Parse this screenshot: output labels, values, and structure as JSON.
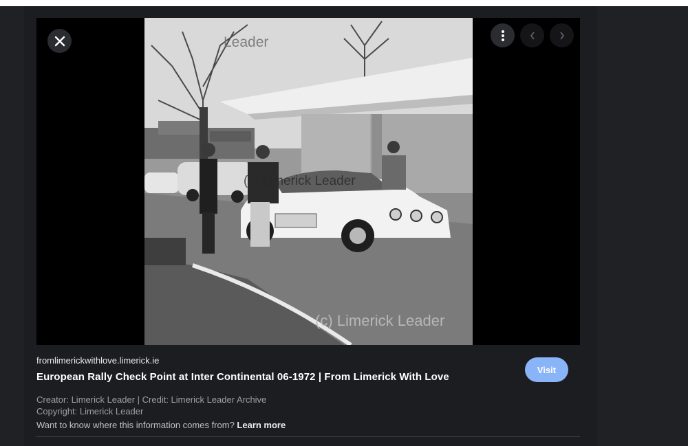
{
  "image": {
    "watermark": "(c) Limerick Leader",
    "watermark_top": "Leader"
  },
  "controls": {
    "close_icon": "close-icon",
    "more_icon": "more-vert-icon",
    "prev_icon": "chevron-left-icon",
    "next_icon": "chevron-right-icon"
  },
  "result": {
    "source": "fromlimerickwithlove.limerick.ie",
    "title": "European Rally Check Point at Inter Continental 06-1972 | From Limerick With Love",
    "visit_label": "Visit",
    "creator": "Creator: Limerick Leader | Credit: Limerick Leader Archive",
    "copyright": "Copyright: Limerick Leader",
    "info_question": "Want to know where this information comes from?",
    "learn_more": "Learn more"
  },
  "colors": {
    "background": "#202124",
    "accent": "#8ab4f8"
  }
}
